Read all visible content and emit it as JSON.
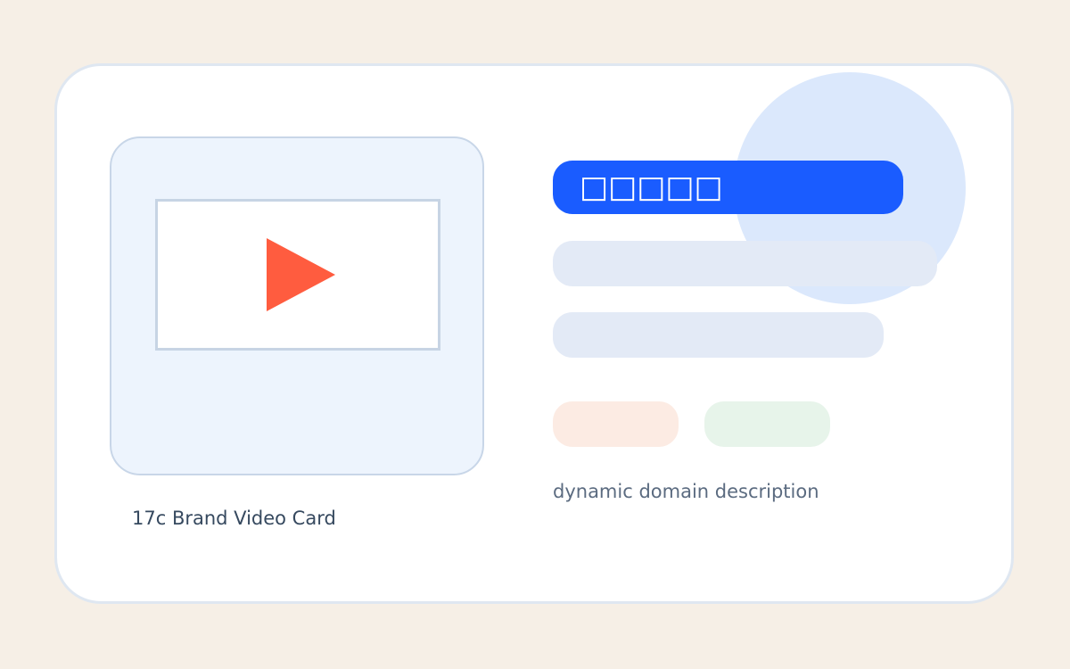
{
  "media": {
    "icon": "play-icon",
    "caption": "17c Brand Video Card"
  },
  "content": {
    "title": "□□□□□",
    "description": "dynamic domain description"
  },
  "colors": {
    "page_background": "#f6efe6",
    "card_background": "#ffffff",
    "accent_blue": "#1a5cff",
    "play_orange": "#ff5c3f",
    "placeholder_blue": "#e3eaf6",
    "chip_orange": "#fcebe3",
    "chip_green": "#e7f4ea",
    "decorative_circle": "#dbe8fc"
  }
}
